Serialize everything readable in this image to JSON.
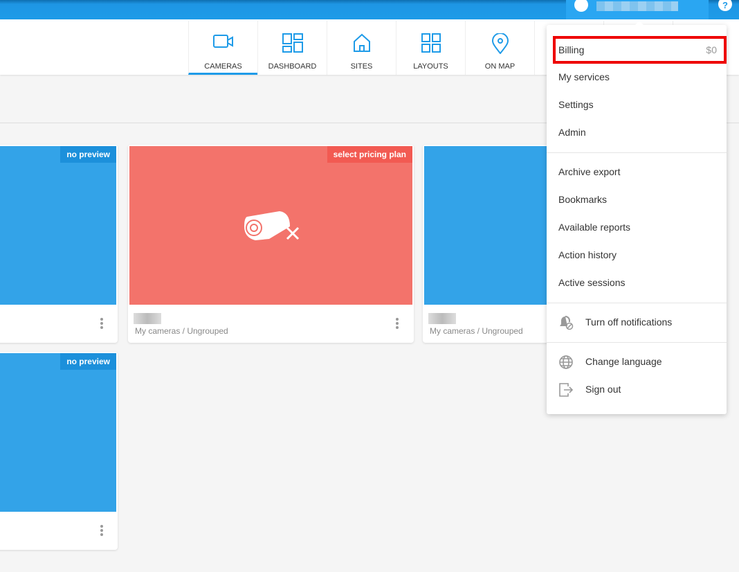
{
  "nav": {
    "tabs": [
      {
        "label": "CAMERAS",
        "icon": "video-camera-icon",
        "active": true
      },
      {
        "label": "DASHBOARD",
        "icon": "dashboard-icon"
      },
      {
        "label": "SITES",
        "icon": "home-icon"
      },
      {
        "label": "LAYOUTS",
        "icon": "grid-icon"
      },
      {
        "label": "ON MAP",
        "icon": "map-pin-icon"
      }
    ]
  },
  "cards": [
    {
      "badge": "no preview",
      "path": ""
    },
    {
      "badge": "select pricing plan",
      "path": "My cameras / Ungrouped"
    },
    {
      "badge": "",
      "path": "My cameras / Ungrouped"
    },
    {
      "badge": "no preview",
      "path": ""
    }
  ],
  "menu": {
    "billing": {
      "label": "Billing",
      "value": "$0"
    },
    "items": [
      "My services",
      "Settings",
      "Admin",
      "Archive export",
      "Bookmarks",
      "Available reports",
      "Action history",
      "Active sessions"
    ],
    "notifications": "Turn off notifications",
    "language": "Change language",
    "signout": "Sign out"
  },
  "colors": {
    "accent": "#1e9be8",
    "preview": "#33a3e8",
    "error": "#f3736b",
    "highlight": "#ee0000"
  }
}
